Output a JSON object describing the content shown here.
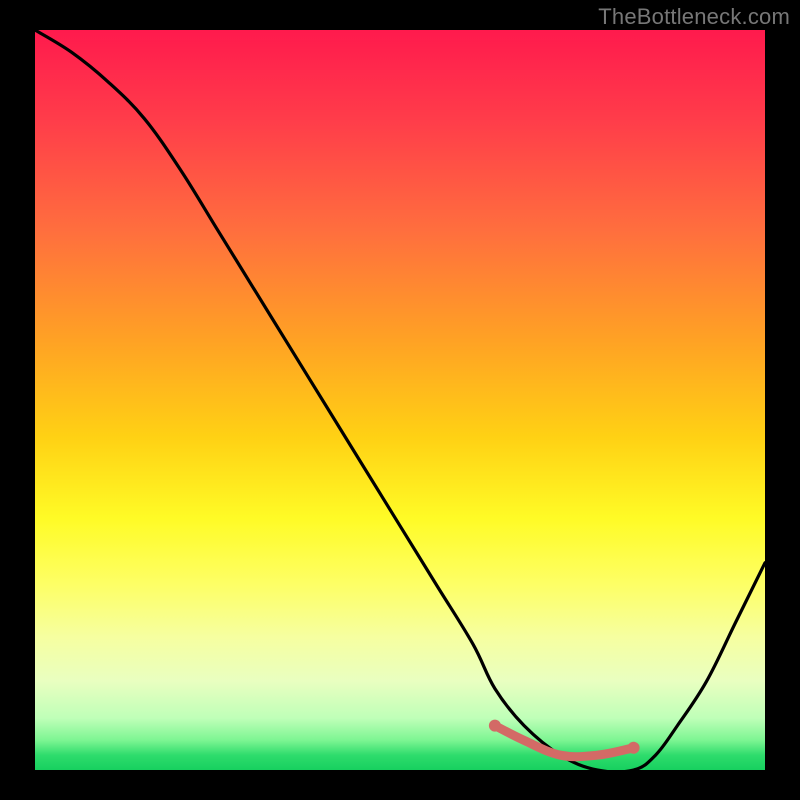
{
  "watermark": "TheBottleneck.com",
  "chart_data": {
    "type": "line",
    "title": "",
    "xlabel": "",
    "ylabel": "",
    "xlim": [
      0,
      100
    ],
    "ylim": [
      0,
      100
    ],
    "grid": false,
    "series": [
      {
        "name": "bottleneck-curve",
        "x": [
          0,
          5,
          10,
          15,
          20,
          25,
          30,
          35,
          40,
          45,
          50,
          55,
          60,
          63,
          67,
          72,
          77,
          82,
          85,
          88,
          92,
          96,
          100
        ],
        "values": [
          100,
          97,
          93,
          88,
          81,
          73,
          65,
          57,
          49,
          41,
          33,
          25,
          17,
          11,
          6,
          2,
          0,
          0,
          2,
          6,
          12,
          20,
          28
        ]
      }
    ],
    "highlight_segment": {
      "name": "optimal-band",
      "x": [
        63,
        67,
        72,
        77,
        82
      ],
      "values": [
        6,
        4,
        2,
        2,
        3
      ]
    },
    "background_gradient_stops": [
      {
        "pos": 0,
        "color": "#ff1a4d"
      },
      {
        "pos": 27,
        "color": "#ff6e3e"
      },
      {
        "pos": 55,
        "color": "#ffd114"
      },
      {
        "pos": 75,
        "color": "#fdff66"
      },
      {
        "pos": 93,
        "color": "#bfffb8"
      },
      {
        "pos": 100,
        "color": "#17d05f"
      }
    ]
  }
}
